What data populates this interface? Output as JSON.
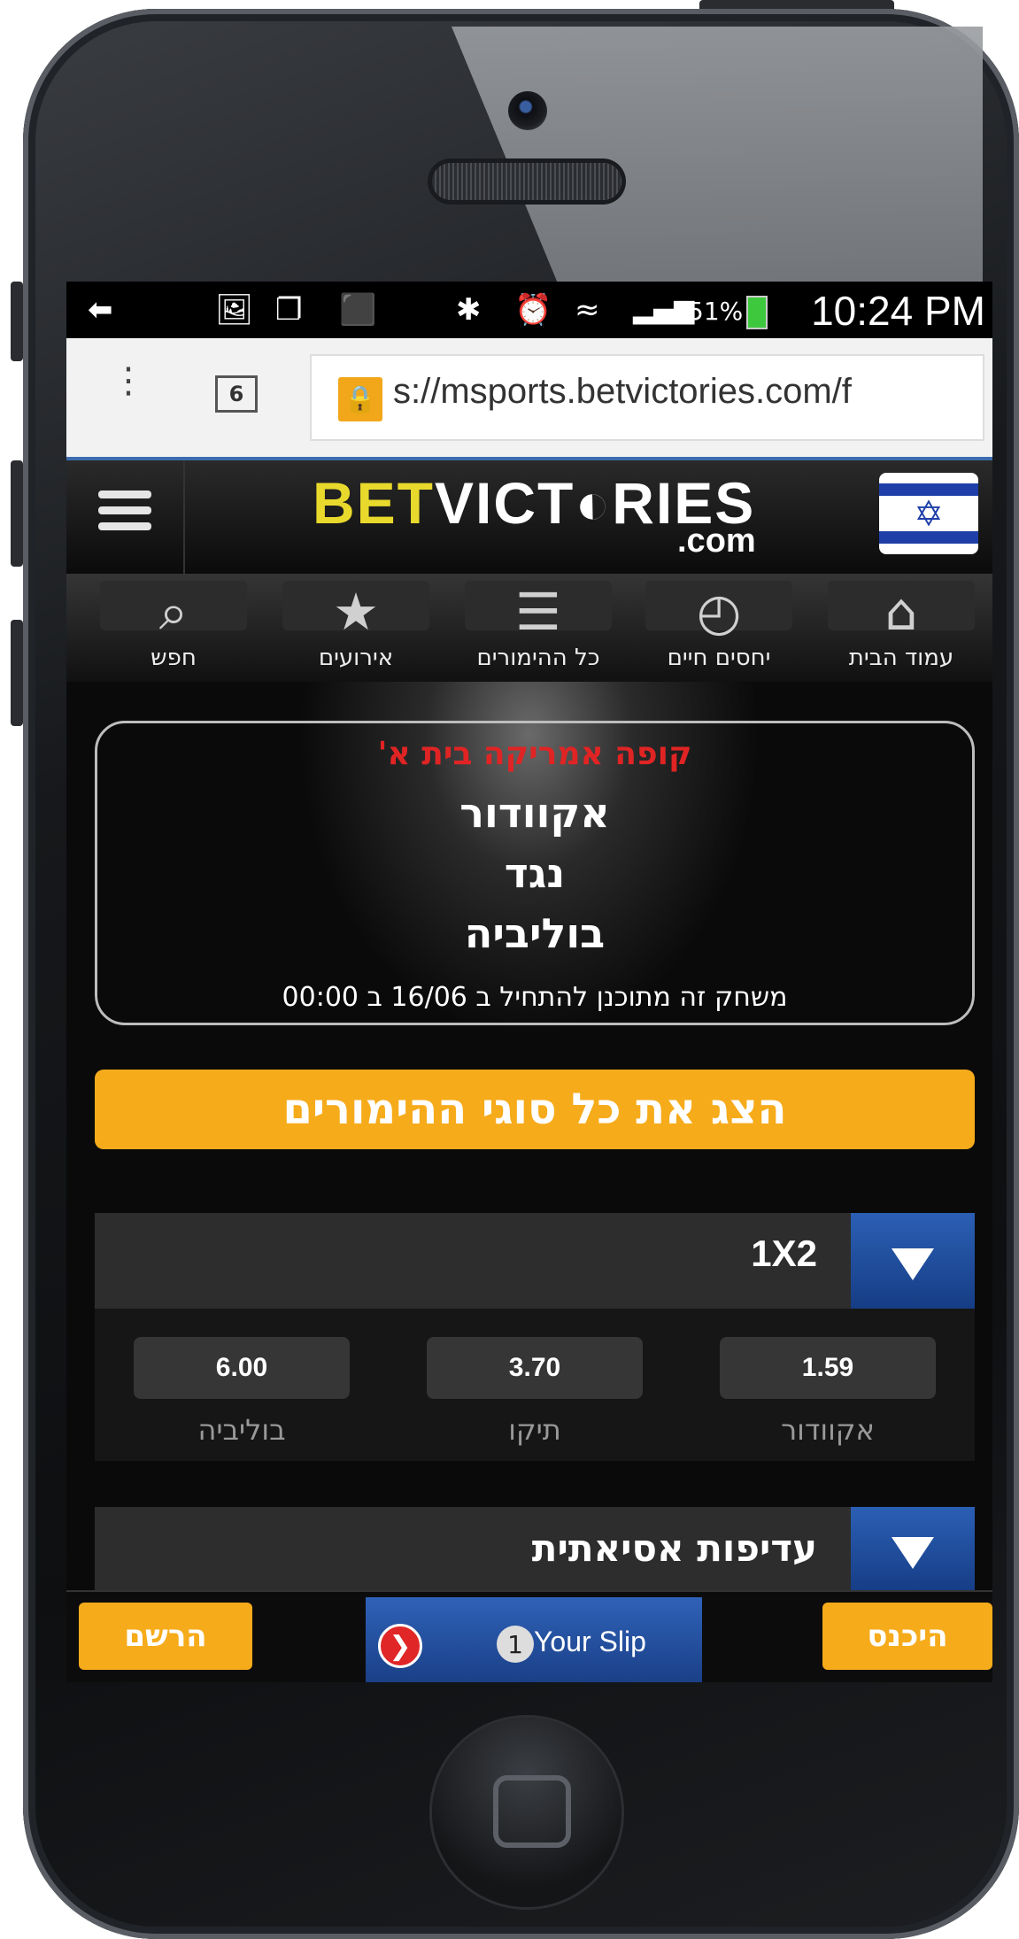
{
  "status_bar": {
    "battery": "51%",
    "time": "10:24 PM",
    "icons": [
      "add-icon",
      "image-icon",
      "app5-icon",
      "notification-icon",
      "bluetooth-icon",
      "alarm-icon",
      "wifi-icon",
      "signal-icon",
      "battery-icon"
    ]
  },
  "browser": {
    "tab_count": "6",
    "url": "s://msports.betvictories.com/f"
  },
  "header": {
    "logo_bet": "BET",
    "logo_victories": "VICT◐RIES",
    "logo_com": ".com",
    "flag_symbol": "✡"
  },
  "nav": {
    "items": [
      {
        "label": "חפש",
        "icon": "⌕"
      },
      {
        "label": "אירועים",
        "icon": "★"
      },
      {
        "label": "כל ההימורים",
        "icon": "☰"
      },
      {
        "label": "יחסים חיים",
        "icon": "◴"
      },
      {
        "label": "עמוד הבית",
        "icon": "⌂"
      }
    ]
  },
  "match": {
    "competition": "קופה אמריקה בית א'",
    "home_team": "אקוודור",
    "versus": "נגד",
    "away_team": "בוליביה",
    "schedule": "משחק זה מתוכנן להתחיל ב 16/06 ב 00:00"
  },
  "show_all_button": "הצג את כל סוגי ההימורים",
  "markets": [
    {
      "title": "1X2",
      "odds": [
        {
          "label": "אקוודור",
          "value": "1.59"
        },
        {
          "label": "תיקו",
          "value": "3.70"
        },
        {
          "label": "בוליביה",
          "value": "6.00"
        }
      ]
    },
    {
      "title": "עדיפות אסיאתית"
    }
  ],
  "bottom_bar": {
    "login": "היכנס",
    "register": "הרשם",
    "slip_count": "1",
    "slip_label": "Your Slip",
    "slip_arrow": "❯"
  },
  "colors": {
    "accent_yellow": "#f6ab1b",
    "accent_blue": "#2b5fb4",
    "competition_red": "#e02424",
    "logo_yellow": "#e9d92c"
  }
}
